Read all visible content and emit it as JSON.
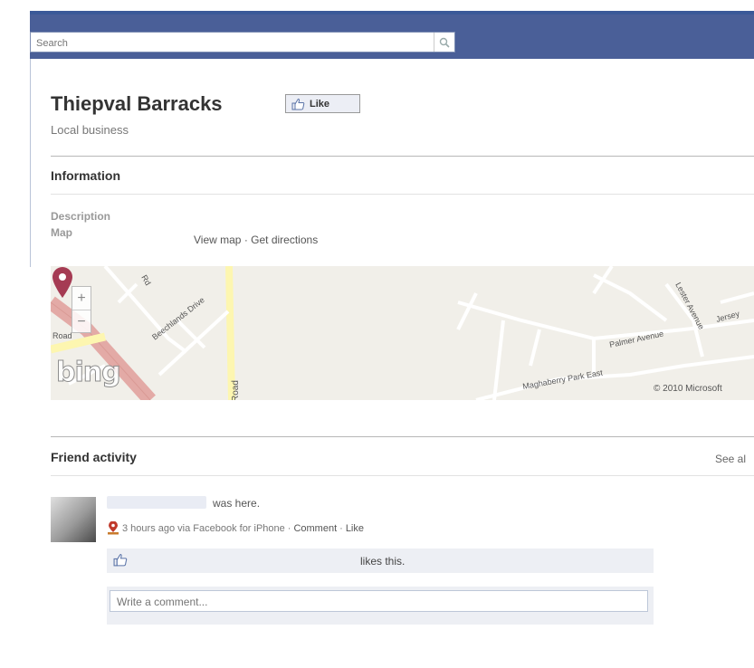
{
  "search": {
    "placeholder": "Search"
  },
  "page": {
    "title": "Thiepval Barracks",
    "like_label": "Like",
    "category": "Local business"
  },
  "information": {
    "heading": "Information",
    "description_label": "Description",
    "map_label": "Map",
    "view_map": "View map",
    "separator": " · ",
    "get_directions": "Get directions"
  },
  "map": {
    "provider": "bing",
    "copyright": "© 2010 Microsoft",
    "street_labels": [
      "Beechlands Drive",
      "Road",
      "Road",
      "Palmer Avenue",
      "Lester Avenue",
      "Jersey",
      "Maghaberry Park East",
      "Rd"
    ],
    "zoom_in": "+",
    "zoom_out": "−"
  },
  "friend_activity": {
    "heading": "Friend activity",
    "see_all": "See al",
    "item": {
      "action": "was here.",
      "time": "3 hours ago via Facebook for iPhone",
      "sep": " · ",
      "comment": "Comment",
      "like": "Like",
      "likes_text": "likes this.",
      "comment_placeholder": "Write a comment..."
    }
  },
  "colors": {
    "topbar": "#4a5f98",
    "pin": "#a53b53",
    "road_pink": "#e3aaa6",
    "road_yellow": "#fdf6b0"
  }
}
